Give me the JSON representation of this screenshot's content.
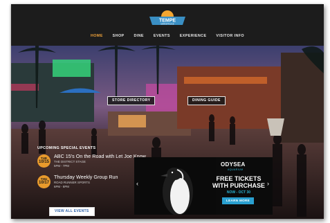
{
  "logo": {
    "line1": "TEMPE",
    "line2": "MARKETPLACE"
  },
  "nav": [
    "HOME",
    "SHOP",
    "DINE",
    "EVENTS",
    "EXPERIENCE",
    "VISITOR INFO"
  ],
  "hero": {
    "store_directory": "STORE DIRECTORY",
    "dining_guide": "DINING GUIDE"
  },
  "events": {
    "title": "UPCOMING SPECIAL EVENTS",
    "items": [
      {
        "dow": "TUE",
        "date": "10/15",
        "title": "ABC 15's On the Road with Let Joe Know",
        "line1": "THE DISTRICT STAGE",
        "line2": "5PM - 7PM"
      },
      {
        "dow": "THU",
        "date": "10/17",
        "title": "Thursday Weekly Group Run",
        "line1": "ROAD RUNNER SPORTS",
        "line2": "6PM - 8PM"
      }
    ],
    "view_all": "VIEW ALL EVENTS"
  },
  "promo": {
    "brand": "ODYSEA",
    "brand_sub": "AQUARIUM",
    "headline_1": "FREE TICKETS",
    "headline_2": "WITH PURCHASE",
    "dates": "NOW - OCT 30",
    "cta": "LEARN MORE",
    "prev_arrow": "‹",
    "next_arrow": "›"
  },
  "colors": {
    "accent": "#e89a2c",
    "nav_active": "#f0a33a",
    "promo_blue": "#2bb6d6"
  }
}
